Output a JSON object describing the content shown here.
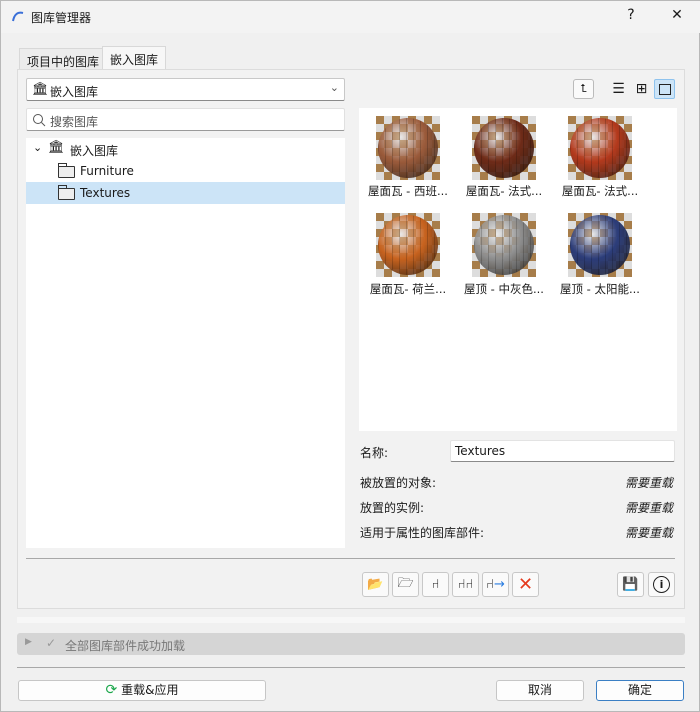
{
  "window": {
    "title": "图库管理器",
    "help": "?",
    "close": "✕"
  },
  "tabs": [
    {
      "label": "项目中的图库"
    },
    {
      "label": "嵌入图库"
    }
  ],
  "library_select": {
    "value": "嵌入图库"
  },
  "search": {
    "placeholder": "搜索图库"
  },
  "tree": {
    "root": "嵌入图库",
    "children": [
      {
        "label": "Furniture"
      },
      {
        "label": "Textures"
      }
    ]
  },
  "thumbnails": [
    {
      "label": "屋面瓦 - 西班...",
      "color": "#9a5a3a"
    },
    {
      "label": "屋面瓦- 法式...",
      "color": "#6e2a17"
    },
    {
      "label": "屋面瓦- 法式...",
      "color": "#b3391c"
    },
    {
      "label": "屋面瓦- 荷兰...",
      "color": "#c7621e"
    },
    {
      "label": "屋顶 - 中灰色...",
      "color": "#8d8d8d"
    },
    {
      "label": "屋顶 - 太阳能...",
      "color": "#2c3d7a"
    }
  ],
  "details": {
    "name_label": "名称:",
    "name_value": "Textures",
    "rows": [
      {
        "label": "被放置的对象:",
        "value": "需要重载"
      },
      {
        "label": "放置的实例:",
        "value": "需要重载"
      },
      {
        "label": "适用于属性的图库部件:",
        "value": "需要重载"
      }
    ]
  },
  "status": {
    "text": "全部图库部件成功加载"
  },
  "buttons": {
    "reload": "重载&应用",
    "cancel": "取消",
    "ok": "确定"
  }
}
